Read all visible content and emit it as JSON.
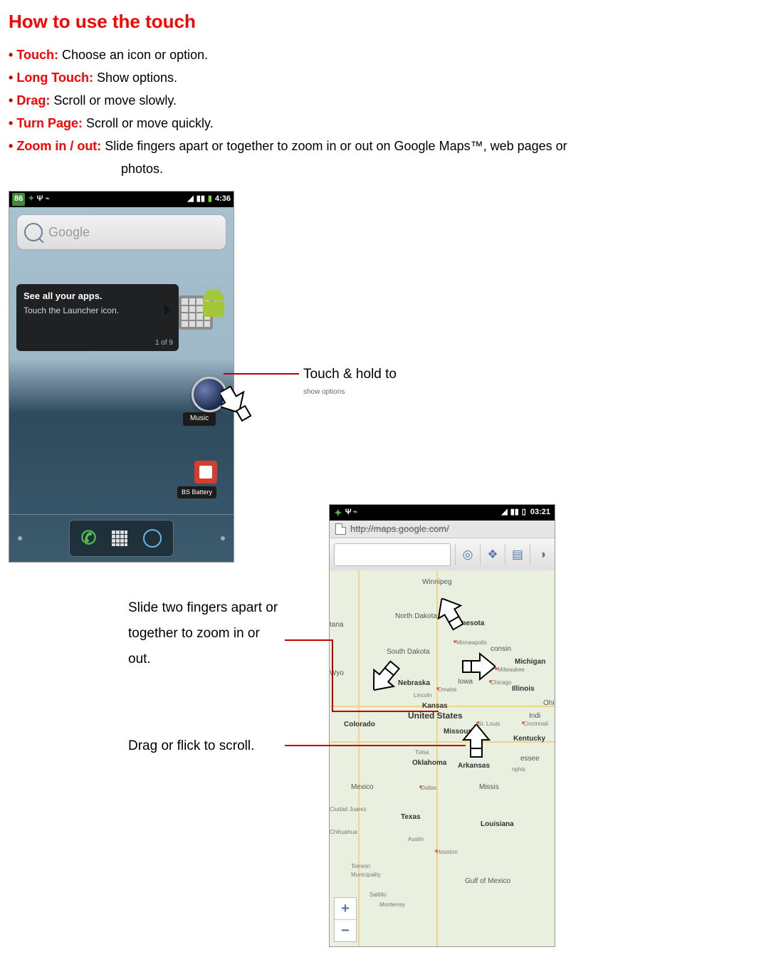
{
  "heading": "How to use the touch",
  "bullets": {
    "touch": {
      "term": "Touch:",
      "desc": " Choose an icon or option."
    },
    "long": {
      "term": "Long Touch:",
      "desc": " Show options."
    },
    "drag": {
      "term": "Drag:",
      "desc": " Scroll or move slowly."
    },
    "turn": {
      "term": "Turn Page:",
      "desc": " Scroll or move quickly."
    },
    "zoom": {
      "term": "Zoom in / out:",
      "desc": " Slide fingers apart or together to zoom in or out on Google Maps™, web pages or"
    },
    "zoom2": "photos."
  },
  "callouts": {
    "touchhold": "Touch & hold to",
    "touchhold2": "show options",
    "pinch": "Slide two fingers apart or together to zoom in or out.",
    "dragflick": "Drag or flick to scroll."
  },
  "phone1": {
    "status": {
      "badge": "86",
      "time": "4:36"
    },
    "search_hint": "Google",
    "tip": {
      "line1": "See all your apps.",
      "line2": "Touch the Launcher icon.",
      "count": "1 of 9"
    },
    "music_label": "Music",
    "bsb_label": "BS Battery"
  },
  "phone2": {
    "status": {
      "time": "03:21"
    },
    "url": "http://maps.google.com/",
    "states": [
      "Winnipeg",
      "North Dakota",
      "Minnesota",
      "South Dakota",
      "Minneapolis",
      "consin",
      "Michigan",
      "Milwaukee",
      "Wyo",
      "Nebraska",
      "Iowa",
      "Chicago",
      "Illinois",
      "Lincoln",
      "Omaha",
      "Ohio",
      "Kansas",
      "Indi",
      "Cincinnati",
      "Colorado",
      "Missouri",
      "St. Louis",
      "Kentucky",
      "Tulsa",
      "Oklahoma",
      "Arkansas",
      "essee",
      "nphis",
      "Mexico",
      "Dallas",
      "Missis",
      "Ciudad Juarez",
      "Chihuahua",
      "Torreón",
      "Municipality",
      "Saltillo",
      "Monterrey",
      "Texas",
      "Austin",
      "Houston",
      "Gulf of Mexico",
      "Louisiana",
      "United States",
      "tana"
    ],
    "toolbar_icons": [
      "locate",
      "layers",
      "list",
      "walk"
    ]
  }
}
